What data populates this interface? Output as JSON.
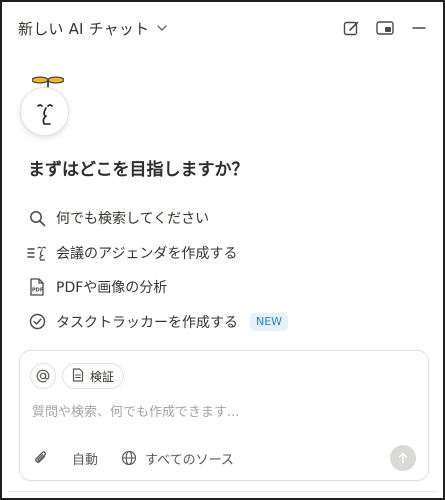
{
  "header": {
    "title": "新しい AI チャット",
    "icons": [
      "chevron-down-icon",
      "new-chat-icon",
      "picture-in-picture-icon",
      "minimize-icon"
    ]
  },
  "avatar": {
    "icon": "notion-ai-face-icon"
  },
  "main": {
    "heading": "まずはどこを目指しますか？",
    "suggestions": [
      {
        "icon": "search-icon",
        "label": "何でも検索してください"
      },
      {
        "icon": "agenda-icon",
        "label": "会議のアジェンダを作成する"
      },
      {
        "icon": "pdf-icon",
        "label": "PDFや画像の分析"
      },
      {
        "icon": "check-circle-icon",
        "label": "タスクトラッカーを作成する",
        "badge": "NEW"
      }
    ]
  },
  "composer": {
    "mention_icon": "at-sign-icon",
    "chip_label": "検証",
    "chip_icon": "document-icon",
    "placeholder": "質問や検索、何でも作成できます...",
    "tools": [
      {
        "icon": "paperclip-icon",
        "label": ""
      },
      {
        "icon": "",
        "label": "自動"
      },
      {
        "icon": "globe-icon",
        "label": "すべてのソース"
      }
    ],
    "send_icon": "arrow-up-icon"
  },
  "colors": {
    "badge_text": "#2d7fd0",
    "badge_bg": "#e7f1fb",
    "send_bg": "#d9d9d7"
  }
}
